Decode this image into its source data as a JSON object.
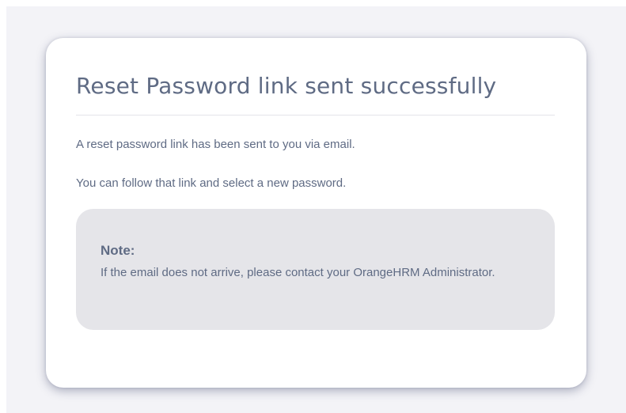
{
  "card": {
    "title": "Reset Password link sent successfully",
    "message_1": "A reset password link has been sent to you via email.",
    "message_2": "You can follow that link and select a new password."
  },
  "note": {
    "title": "Note:",
    "text": "If the email does not arrive, please contact your OrangeHRM Administrator."
  },
  "colors": {
    "background": "#f3f3f7",
    "card": "#ffffff",
    "text": "#5f6b84",
    "note_background": "#e5e5e9"
  }
}
